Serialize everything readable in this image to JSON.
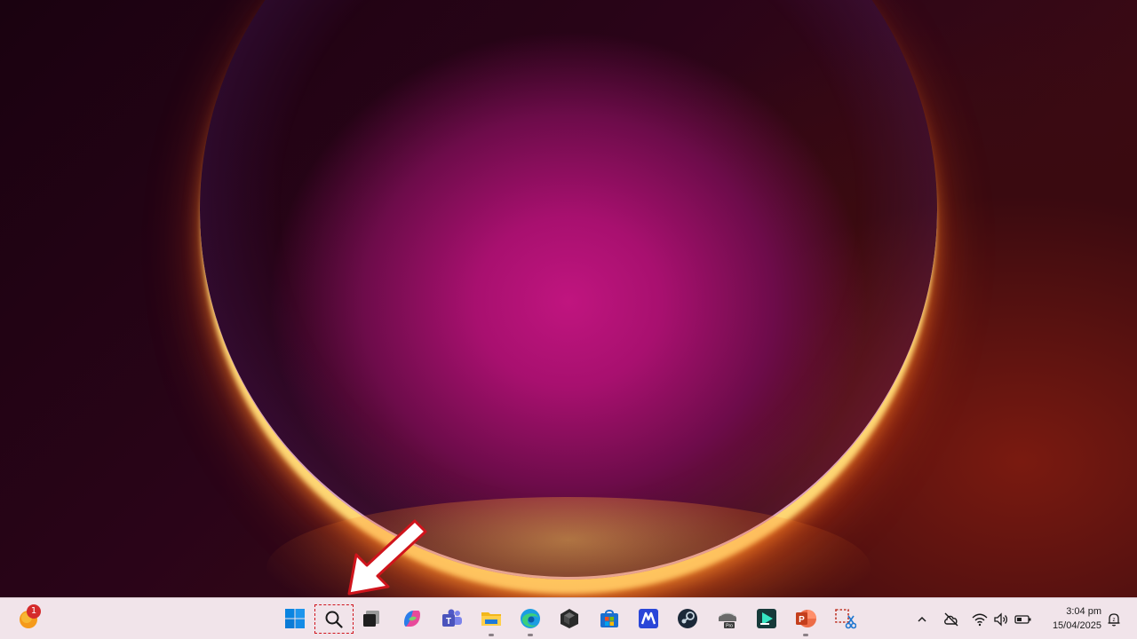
{
  "taskbar": {
    "widgets": {
      "icon": "weather-widget-icon",
      "badge": "1"
    },
    "pinned": [
      {
        "name": "start",
        "icon": "windows-start-icon"
      },
      {
        "name": "search",
        "icon": "search-icon"
      },
      {
        "name": "task-view",
        "icon": "task-view-icon"
      },
      {
        "name": "copilot",
        "icon": "copilot-icon"
      },
      {
        "name": "teams",
        "icon": "teams-icon"
      },
      {
        "name": "file-explorer",
        "icon": "folder-icon"
      },
      {
        "name": "edge",
        "icon": "edge-browser-icon"
      },
      {
        "name": "obs",
        "icon": "cube-app-icon"
      },
      {
        "name": "store",
        "icon": "microsoft-store-icon"
      },
      {
        "name": "mail",
        "icon": "m-app-icon"
      },
      {
        "name": "steam",
        "icon": "steam-icon"
      },
      {
        "name": "scanner",
        "icon": "scanner-pro-icon"
      },
      {
        "name": "filmora",
        "icon": "filmora-icon"
      },
      {
        "name": "powerpoint",
        "icon": "powerpoint-icon"
      },
      {
        "name": "snipping-tool",
        "icon": "snipping-tool-icon"
      }
    ],
    "tray": {
      "chevron": "chevron-up-icon",
      "onedrive": "cloud-off-icon",
      "wifi": "wifi-icon",
      "volume": "speaker-icon",
      "battery": "battery-icon",
      "notifications": "notification-icon"
    },
    "clock": {
      "time": "3:04 pm",
      "date": "15/04/2025"
    }
  },
  "colors": {
    "taskbar_bg": "#f1e4ea",
    "highlight": "#d0141c",
    "accent_blue": "#0078d4"
  }
}
